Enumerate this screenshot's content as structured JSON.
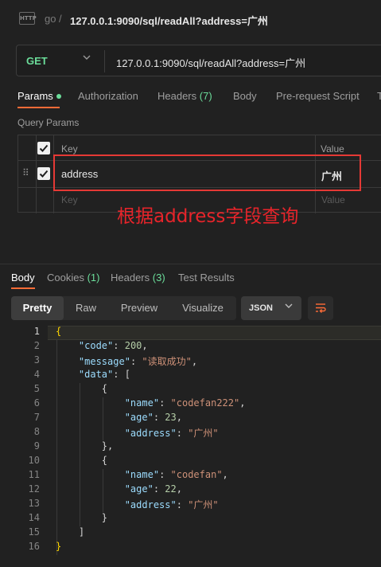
{
  "header": {
    "icon_label": "HTTP",
    "collection": "go",
    "separator": "/",
    "request_name": "127.0.0.1:9090/sql/readAll?address=广州"
  },
  "url_bar": {
    "method": "GET",
    "url": "127.0.0.1:9090/sql/readAll?address=广州"
  },
  "request_tabs": {
    "params": "Params",
    "authorization": "Authorization",
    "headers": "Headers",
    "headers_count": "(7)",
    "body": "Body",
    "prerequest": "Pre-request Script",
    "overflow": "T"
  },
  "query_params": {
    "title": "Query Params",
    "col_key": "Key",
    "col_value": "Value",
    "rows": [
      {
        "key": "address",
        "value": "广州",
        "checked": true
      }
    ],
    "key_placeholder": "Key",
    "value_placeholder": "Value"
  },
  "annotation": "根据address字段查询",
  "response_tabs": {
    "body": "Body",
    "cookies": "Cookies",
    "cookies_count": "(1)",
    "headers": "Headers",
    "headers_count": "(3)",
    "tests": "Test Results"
  },
  "view_modes": [
    "Pretty",
    "Raw",
    "Preview",
    "Visualize"
  ],
  "format": "JSON",
  "line_numbers": [
    "1",
    "2",
    "3",
    "4",
    "5",
    "6",
    "7",
    "8",
    "9",
    "10",
    "11",
    "12",
    "13",
    "14",
    "15",
    "16"
  ],
  "code": {
    "open_brace": "{",
    "code_key": "\"code\"",
    "code_val": "200",
    "message_key": "\"message\"",
    "message_val": "\"读取成功\"",
    "data_key": "\"data\"",
    "items": [
      {
        "name_key": "\"name\"",
        "name_val": "\"codefan222\"",
        "age_key": "\"age\"",
        "age_val": "23",
        "address_key": "\"address\"",
        "address_val": "\"广州\""
      },
      {
        "name_key": "\"name\"",
        "name_val": "\"codefan\"",
        "age_key": "\"age\"",
        "age_val": "22",
        "address_key": "\"address\"",
        "address_val": "\"广州\""
      }
    ],
    "close_brace": "}"
  },
  "colors": {
    "accent": "#ff6c37",
    "method_green": "#6bdd9a",
    "annotation_red": "#e8242a"
  }
}
